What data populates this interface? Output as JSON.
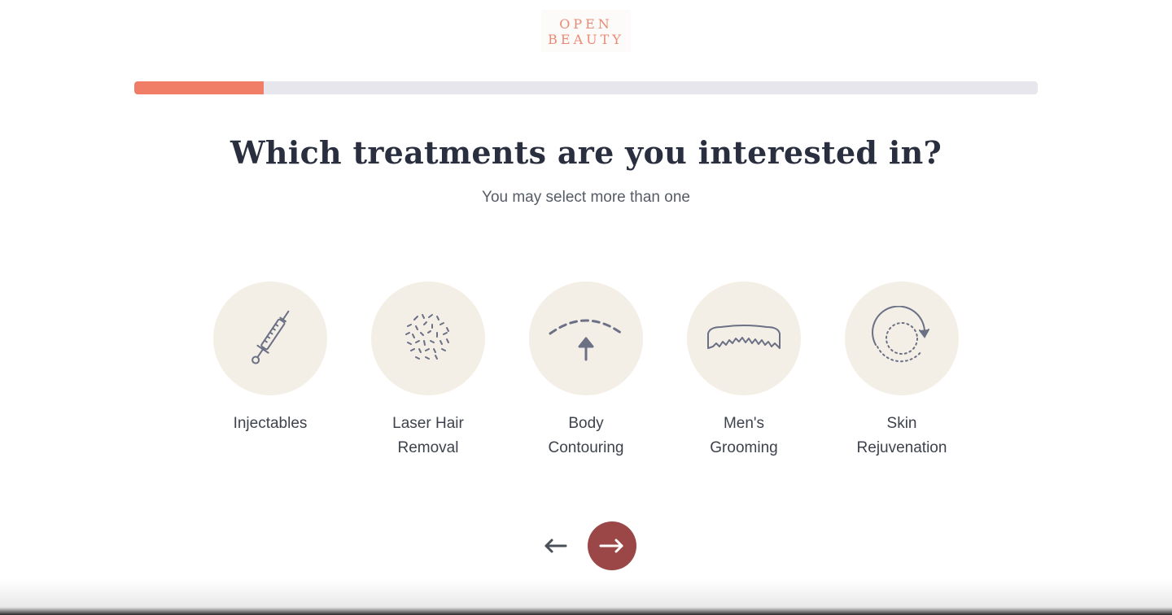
{
  "brand": {
    "line1": "OPEN",
    "line2": "BEAUTY"
  },
  "progress": {
    "fraction": 0.143,
    "fill_color": "#f07e66",
    "track_color": "#e6e6ec"
  },
  "question": {
    "title": "Which treatments are you interested in?",
    "subtitle": "You may select more than one"
  },
  "options": [
    {
      "label": "Injectables",
      "icon": "syringe-icon"
    },
    {
      "label": "Laser Hair Removal",
      "icon": "hair-stubble-icon"
    },
    {
      "label": "Body Contouring",
      "icon": "body-contour-arrow-icon"
    },
    {
      "label": "Men's Grooming",
      "icon": "mustache-icon"
    },
    {
      "label": "Skin Rejuvenation",
      "icon": "rotate-circle-icon"
    }
  ],
  "nav": {
    "back_icon": "arrow-left-icon",
    "next_icon": "arrow-right-icon",
    "next_color": "#9c4747"
  },
  "colors": {
    "circle_bg": "#f3efe6",
    "icon_stroke": "#6b7085",
    "brand": "#e98a72"
  }
}
